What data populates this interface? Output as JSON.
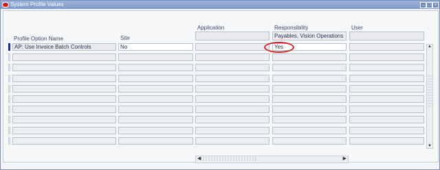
{
  "window": {
    "title": "System Profile Values"
  },
  "headers": {
    "profile_option": "Profile Option Name",
    "site": "Site",
    "application": "Application",
    "responsibility": "Responsibility",
    "user": "User"
  },
  "context": {
    "responsibility_value": "Payables, Vision Operations"
  },
  "rows": [
    {
      "profile_option": "AP: Use Invoice Batch Controls",
      "site": "No",
      "application": "",
      "responsibility": "Yes",
      "user": ""
    },
    {
      "profile_option": "",
      "site": "",
      "application": "",
      "responsibility": "",
      "user": ""
    },
    {
      "profile_option": "",
      "site": "",
      "application": "",
      "responsibility": "",
      "user": ""
    },
    {
      "profile_option": "",
      "site": "",
      "application": "",
      "responsibility": "",
      "user": ""
    },
    {
      "profile_option": "",
      "site": "",
      "application": "",
      "responsibility": "",
      "user": ""
    },
    {
      "profile_option": "",
      "site": "",
      "application": "",
      "responsibility": "",
      "user": ""
    },
    {
      "profile_option": "",
      "site": "",
      "application": "",
      "responsibility": "",
      "user": ""
    },
    {
      "profile_option": "",
      "site": "",
      "application": "",
      "responsibility": "",
      "user": ""
    },
    {
      "profile_option": "",
      "site": "",
      "application": "",
      "responsibility": "",
      "user": ""
    },
    {
      "profile_option": "",
      "site": "",
      "application": "",
      "responsibility": "",
      "user": ""
    }
  ],
  "colors": {
    "titlebar": "#8aa2d0",
    "highlight": "#d62020",
    "current_row_indicator": "#1c2c8c"
  },
  "icons": {
    "app": "oracle-o-icon",
    "minimize": "minimize-icon",
    "maximize": "maximize-icon",
    "close": "close-icon"
  }
}
